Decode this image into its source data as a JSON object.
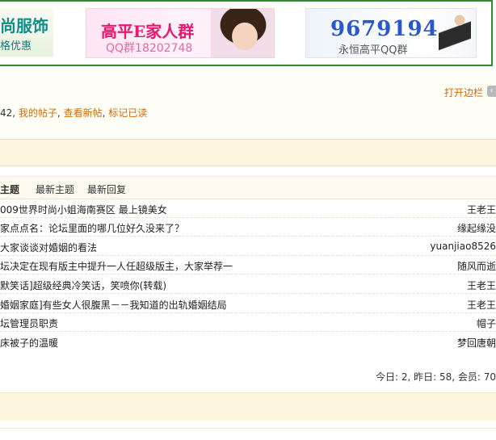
{
  "banner": {
    "ad1": {
      "line1": "尚服饰",
      "line2": "格优惠"
    },
    "ad2": {
      "line1": "高平E家人群",
      "line2": "QQ群18202748"
    },
    "ad3": {
      "line1": "9679194",
      "line2": "永恒高平QQ群"
    }
  },
  "sidebar_toggle": {
    "label": "打开边栏",
    "icon": "arrow-left-icon"
  },
  "userlinks": {
    "prefix": "42, ",
    "my_posts": "我的帖子",
    "sep1": ", ",
    "new_posts": "查看新帖",
    "sep2": ", ",
    "mark_read": "标记已读"
  },
  "tabs": [
    {
      "label": "主题"
    },
    {
      "label": "最新主题"
    },
    {
      "label": "最新回复"
    }
  ],
  "threads": [
    {
      "title": "009世界时尚小姐海南赛区  最上镜美女",
      "author": "王老王"
    },
    {
      "title": "家点点名：论坛里面的哪几位好久没来了？",
      "author": "缘起缘没"
    },
    {
      "title": "大家谈谈对婚姻的看法",
      "author": "yuanjiao8526"
    },
    {
      "title": "坛决定在现有版主中提升一人任超级版主，大家举荐一",
      "author": "随风而逝"
    },
    {
      "title": "默笑话]超级经典冷笑话，笑喷你(转载)",
      "author": "王老王"
    },
    {
      "title": "婚姻家庭]有些女人很腹黑－－我知道的出轨婚姻结局",
      "author": "王老王"
    },
    {
      "title": "坛管理员职责",
      "author": "帽子"
    },
    {
      "title": "床被子的温暖",
      "author": "梦回唐朝"
    }
  ],
  "stats": "今日: 2, 昨日: 58, 会员: 70"
}
